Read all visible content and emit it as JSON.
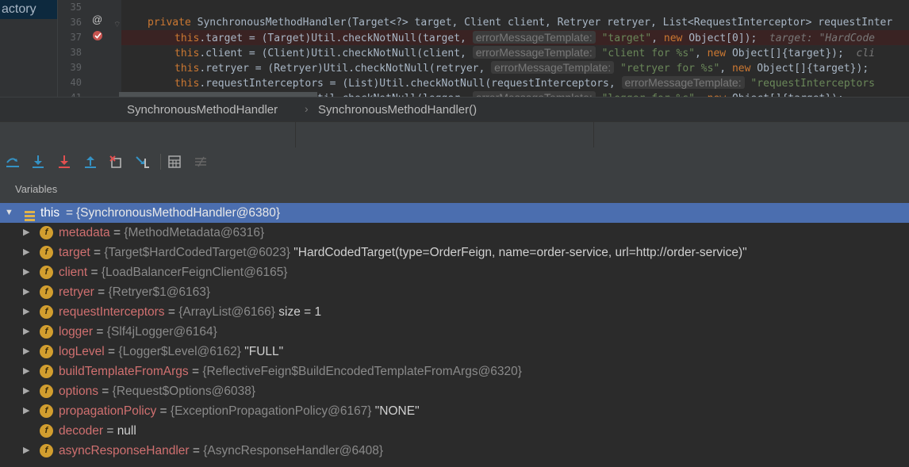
{
  "editor": {
    "left_tab_label": "actory",
    "line_numbers": [
      "35",
      "36",
      "37",
      "38",
      "39",
      "40",
      "41"
    ],
    "lines": [
      {
        "tokens": [
          {
            "t": "private ",
            "c": "kw"
          },
          {
            "t": "SynchronousMethodHandler(Target<?> target, Client client, Retryer retryer, List<RequestInterceptor> requestInter",
            "c": ""
          }
        ]
      },
      {
        "tokens": [
          {
            "t": "this",
            "c": "kw"
          },
          {
            "t": ".target = (Target)Util.",
            "c": ""
          },
          {
            "t": "checkNotNull",
            "c": ""
          },
          {
            "t": "(target, ",
            "c": ""
          },
          {
            "t": "errorMessageTemplate:",
            "c": "hint"
          },
          {
            "t": " \"target\"",
            "c": "str"
          },
          {
            "t": ", ",
            "c": ""
          },
          {
            "t": "new ",
            "c": "kw"
          },
          {
            "t": "Object[",
            "c": ""
          },
          {
            "t": "0",
            "c": ""
          },
          {
            "t": "]);  ",
            "c": ""
          },
          {
            "t": "target: \"HardCode",
            "c": "itc"
          }
        ]
      },
      {
        "tokens": [
          {
            "t": "this",
            "c": "kw"
          },
          {
            "t": ".client = (Client)Util.checkNotNull(client, ",
            "c": ""
          },
          {
            "t": "errorMessageTemplate:",
            "c": "hint"
          },
          {
            "t": " \"client for %s\"",
            "c": "str"
          },
          {
            "t": ", ",
            "c": ""
          },
          {
            "t": "new ",
            "c": "kw"
          },
          {
            "t": "Object[]{target});  ",
            "c": ""
          },
          {
            "t": "cli",
            "c": "itc"
          }
        ]
      },
      {
        "tokens": [
          {
            "t": "this",
            "c": "kw"
          },
          {
            "t": ".retryer = (Retryer)Util.checkNotNull(retryer, ",
            "c": ""
          },
          {
            "t": "errorMessageTemplate:",
            "c": "hint"
          },
          {
            "t": " \"retryer for %s\"",
            "c": "str"
          },
          {
            "t": ", ",
            "c": ""
          },
          {
            "t": "new ",
            "c": "kw"
          },
          {
            "t": "Object[]{target});",
            "c": ""
          }
        ]
      },
      {
        "tokens": [
          {
            "t": "this",
            "c": "kw"
          },
          {
            "t": ".requestInterceptors = (List)Util.checkNotNull(requestInterceptors, ",
            "c": ""
          },
          {
            "t": "errorMessageTemplate:",
            "c": "hint"
          },
          {
            "t": " \"requestInterceptors",
            "c": "str"
          }
        ]
      },
      {
        "tokens": [
          {
            "t": "this",
            "c": "kw"
          },
          {
            "t": ".logger = (Logger)Util.checkNotNull(logger, ",
            "c": ""
          },
          {
            "t": "errorMessageTemplate:",
            "c": "hint"
          },
          {
            "t": " \"logger for %s\"",
            "c": "str"
          },
          {
            "t": ", ",
            "c": ""
          },
          {
            "t": "new ",
            "c": "kw"
          },
          {
            "t": "Object[]{target});",
            "c": ""
          }
        ]
      }
    ],
    "gutter_icons": {
      "line36": "@",
      "line37": "breakpoint"
    }
  },
  "breadcrumb": {
    "class_name": "SynchronousMethodHandler",
    "method_name": "SynchronousMethodHandler()"
  },
  "toolbar": {
    "buttons": [
      {
        "name": "step-over-icon"
      },
      {
        "name": "step-into-icon"
      },
      {
        "name": "force-step-into-icon"
      },
      {
        "name": "step-out-icon"
      },
      {
        "name": "drop-frame-icon"
      },
      {
        "name": "run-to-cursor-icon"
      },
      {
        "name": "evaluate-expression-icon"
      },
      {
        "name": "trace-current-stream-icon"
      }
    ]
  },
  "variables": {
    "title": "Variables",
    "root": {
      "name": "this",
      "value": "{SynchronousMethodHandler@6380}"
    },
    "items": [
      {
        "name": "metadata",
        "type": "{MethodMetadata@6316}",
        "extra": "",
        "expandable": true
      },
      {
        "name": "target",
        "type": "{Target$HardCodedTarget@6023}",
        "extra": "\"HardCodedTarget(type=OrderFeign, name=order-service, url=http://order-service)\"",
        "expandable": true
      },
      {
        "name": "client",
        "type": "{LoadBalancerFeignClient@6165}",
        "extra": "",
        "expandable": true
      },
      {
        "name": "retryer",
        "type": "{Retryer$1@6163}",
        "extra": "",
        "expandable": true
      },
      {
        "name": "requestInterceptors",
        "type": "{ArrayList@6166}",
        "extra": " size = 1",
        "expandable": true
      },
      {
        "name": "logger",
        "type": "{Slf4jLogger@6164}",
        "extra": "",
        "expandable": true
      },
      {
        "name": "logLevel",
        "type": "{Logger$Level@6162}",
        "extra": "\"FULL\"",
        "expandable": true
      },
      {
        "name": "buildTemplateFromArgs",
        "type": "{ReflectiveFeign$BuildEncodedTemplateFromArgs@6320}",
        "extra": "",
        "expandable": true
      },
      {
        "name": "options",
        "type": "{Request$Options@6038}",
        "extra": "",
        "expandable": true
      },
      {
        "name": "propagationPolicy",
        "type": "{ExceptionPropagationPolicy@6167}",
        "extra": "\"NONE\"",
        "expandable": true
      },
      {
        "name": "decoder",
        "type": "null",
        "extra": "",
        "expandable": false
      },
      {
        "name": "asyncResponseHandler",
        "type": "{AsyncResponseHandler@6408}",
        "extra": "",
        "expandable": true
      }
    ]
  },
  "colors": {
    "selection": "#4b6eaf",
    "field_name": "#d07070",
    "field_icon": "#d29e2f"
  }
}
